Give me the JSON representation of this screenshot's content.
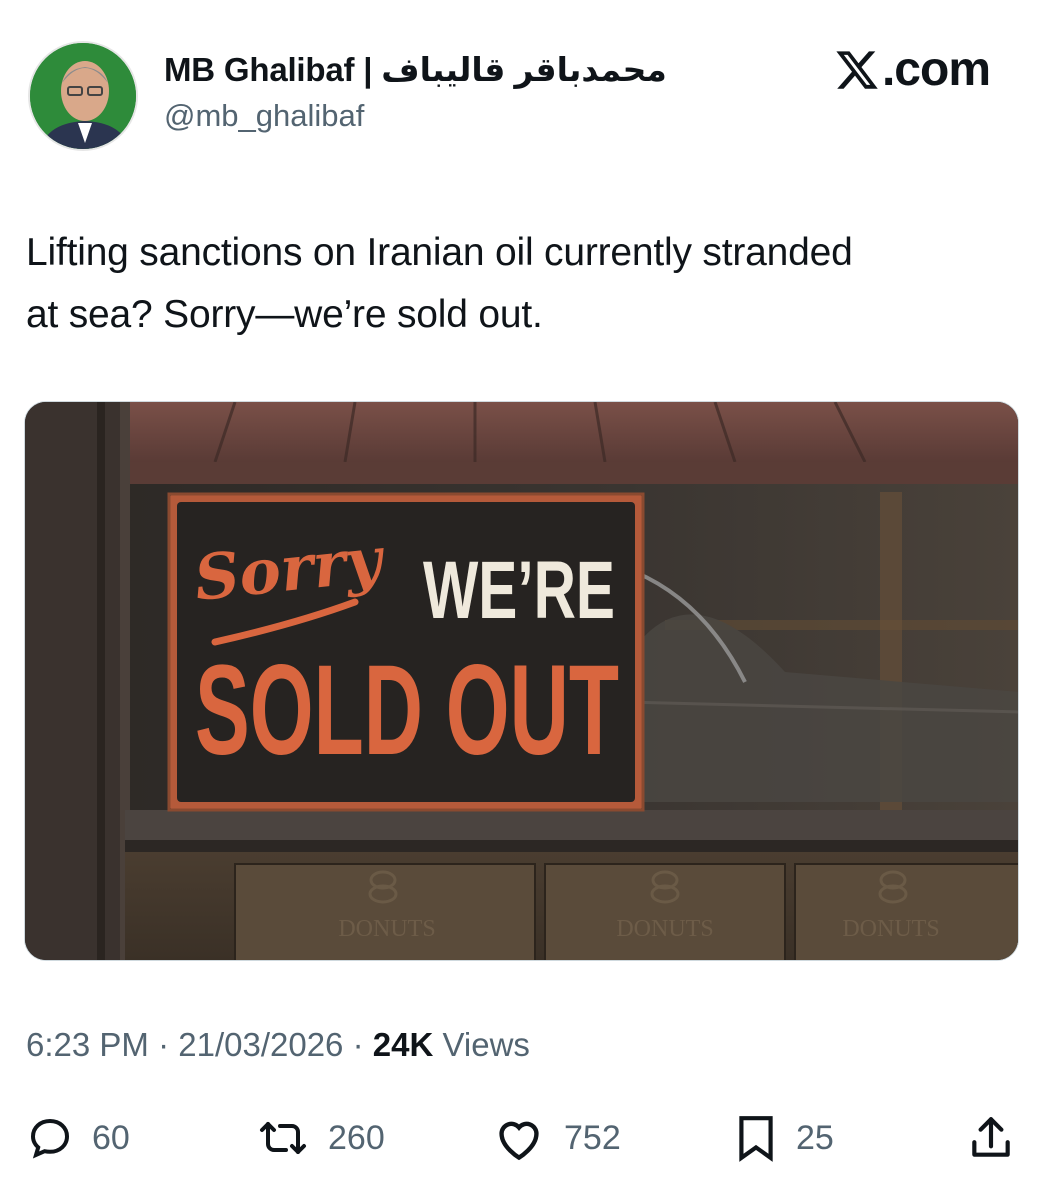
{
  "author": {
    "display_name": "MB Ghalibaf | محمدباقر قالیباف",
    "handle": "@mb_ghalibaf"
  },
  "brand": {
    "label": ".com"
  },
  "tweet": {
    "text_line1": "Lifting sanctions on Iranian oil currently stranded",
    "text_line2": "at sea? Sorry—we’re sold out."
  },
  "media": {
    "sign_script": "Sorry",
    "sign_were": "WE’RE",
    "sign_sold_out": "SOLD OUT",
    "box_label": "DONUTS"
  },
  "meta": {
    "time": "6:23 PM",
    "separator": "·",
    "date": "21/03/2026",
    "views_count": "24K",
    "views_label": "Views"
  },
  "actions": {
    "replies": "60",
    "reposts": "260",
    "likes": "752",
    "bookmarks": "25"
  },
  "colors": {
    "text": "#0f1419",
    "secondary": "#536471",
    "sign_orange": "#d9663f",
    "sign_cream": "#efe9dc",
    "avatar_green": "#2e8b3a"
  },
  "icons": [
    "x-logo-icon",
    "reply-icon",
    "repost-icon",
    "like-icon",
    "bookmark-icon",
    "share-icon"
  ]
}
